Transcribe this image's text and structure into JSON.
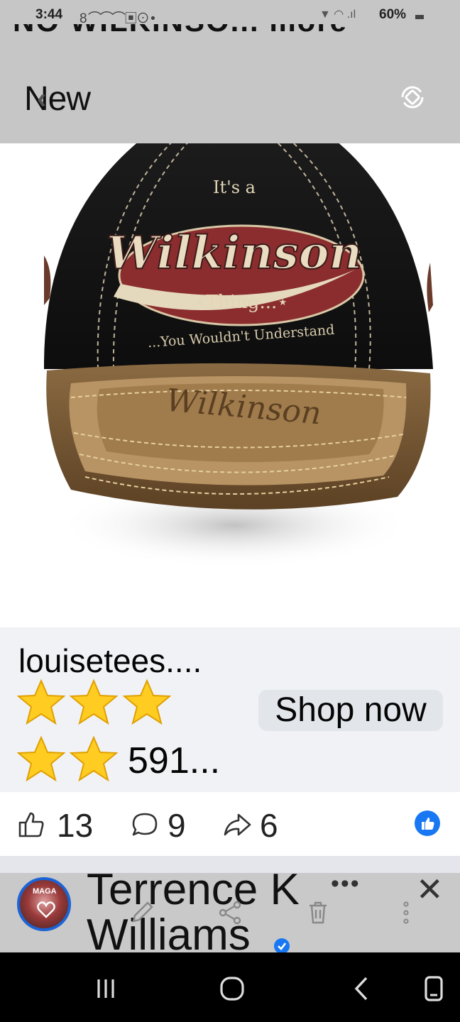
{
  "status_bar": {
    "time": "3:44",
    "notifications": "8 ⌒⌒⌒▣⊙ •",
    "signal_icons": "▼ ◠ .ıl",
    "battery": "60%"
  },
  "header": {
    "ghost_title": "NO WILKINSO... more",
    "back_label": "New"
  },
  "product": {
    "hat_text": {
      "top": "It's a",
      "name": "Wilkinson",
      "middle": "⋆Thing...⋆",
      "bottom": "...You Wouldn't Understand",
      "brim": "Wilkinson"
    },
    "brand": "louisetees....",
    "rating_stars": 5,
    "rating_count": "591...",
    "shop_button": "Shop now"
  },
  "reactions": {
    "likes": "13",
    "comments": "9",
    "shares": "6"
  },
  "next_post": {
    "author": "Terrence K Williams",
    "avatar_text": "MAGA"
  },
  "colors": {
    "facebook_blue": "#1877f2",
    "overlay_gray": "#c6c6c6",
    "product_bg": "#f0f2f5",
    "star_gold": "#ffcc22"
  }
}
